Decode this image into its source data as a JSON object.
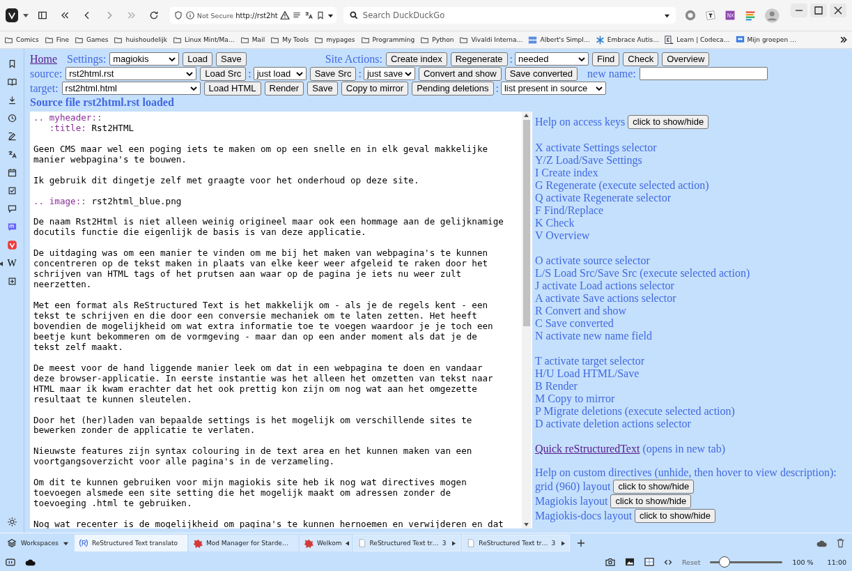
{
  "browser": {
    "address": {
      "security": "Not Secure",
      "url": "http://rst2ht"
    },
    "search": {
      "placeholder": "Search DuckDuckGo"
    }
  },
  "bookmarks": [
    {
      "label": "Comics",
      "kind": "folder"
    },
    {
      "label": "Fine",
      "kind": "folder"
    },
    {
      "label": "Games",
      "kind": "folder"
    },
    {
      "label": "huishoudelijk",
      "kind": "folder"
    },
    {
      "label": "Linux Mint/Ma…",
      "kind": "folder"
    },
    {
      "label": "Mail",
      "kind": "folder"
    },
    {
      "label": "My Tools",
      "kind": "folder"
    },
    {
      "label": "mypages",
      "kind": "folder"
    },
    {
      "label": "Programming",
      "kind": "folder"
    },
    {
      "label": "Python",
      "kind": "folder"
    },
    {
      "label": "Vivaldi Interna…",
      "kind": "folder"
    },
    {
      "label": "Albert's Simpl…",
      "kind": "logs"
    },
    {
      "label": "Embrace Autis…",
      "kind": "snowflake"
    },
    {
      "label": "Learn | Codeca…",
      "kind": "code"
    },
    {
      "label": "Mijn groepen …",
      "kind": "group"
    }
  ],
  "sidebar": {
    "glyph": "W"
  },
  "form": {
    "lines": [
      {
        "controls": [
          {
            "kind": "link",
            "text": "Home"
          },
          {
            "kind": "label",
            "text": "Settings:"
          },
          {
            "kind": "select",
            "value": "magiokis"
          },
          {
            "kind": "button",
            "text": "Load"
          },
          {
            "kind": "button",
            "text": "Save"
          },
          {
            "kind": "section",
            "text": "Site Actions:"
          },
          {
            "kind": "button",
            "text": "Create index"
          },
          {
            "kind": "button",
            "text": "Regenerate"
          },
          {
            "kind": "sep",
            "text": ":"
          },
          {
            "kind": "select",
            "value": "needed"
          },
          {
            "kind": "button",
            "text": "Find"
          },
          {
            "kind": "button",
            "text": "Check"
          },
          {
            "kind": "button",
            "text": "Overview"
          }
        ]
      },
      {
        "controls": [
          {
            "kind": "label",
            "text": "source:"
          },
          {
            "kind": "select",
            "value": "rst2html.rst"
          },
          {
            "kind": "button",
            "text": "Load Src"
          },
          {
            "kind": "sep",
            "text": ":"
          },
          {
            "kind": "select",
            "value": "just load"
          },
          {
            "kind": "button",
            "text": "Save Src"
          },
          {
            "kind": "sep",
            "text": ":"
          },
          {
            "kind": "select",
            "value": "just save"
          },
          {
            "kind": "button",
            "text": "Convert and show"
          },
          {
            "kind": "button",
            "text": "Save converted"
          },
          {
            "kind": "label",
            "text": "new name:"
          },
          {
            "kind": "input"
          }
        ]
      },
      {
        "controls": [
          {
            "kind": "label",
            "text": "target:"
          },
          {
            "kind": "select",
            "value": "rst2html.html"
          },
          {
            "kind": "button",
            "text": "Load HTML"
          },
          {
            "kind": "button",
            "text": "Render"
          },
          {
            "kind": "button",
            "text": "Save"
          },
          {
            "kind": "button",
            "text": "Copy to mirror"
          },
          {
            "kind": "button",
            "text": "Pending deletions"
          },
          {
            "kind": "sep",
            "text": ":"
          },
          {
            "kind": "select",
            "value": "list present in source"
          }
        ]
      }
    ],
    "message": "Source file rst2html.rst loaded"
  },
  "editor": {
    "paragraphs": [
      {
        "lines": [
          {
            "directive": ".. myheader::"
          },
          {
            "directive": "   :title:",
            "text": " Rst2HTML"
          }
        ]
      },
      {
        "lines": [
          {
            "text": "Geen CMS maar wel een poging iets te maken om op een snelle en in elk geval makkelijke"
          },
          {
            "text": "manier webpagina's te bouwen."
          }
        ]
      },
      {
        "lines": [
          {
            "text": "Ik gebruik dit dingetje zelf met graagte voor het onderhoud op deze site."
          }
        ]
      },
      {
        "lines": [
          {
            "directive": ".. image::",
            "text": " rst2html_blue.png"
          }
        ]
      },
      {
        "lines": [
          {
            "text": "De naam Rst2Html is niet alleen weinig origineel maar ook een hommage aan de gelijknamige"
          },
          {
            "text": "docutils functie die eigenlijk de basis is van deze applicatie."
          }
        ]
      },
      {
        "lines": [
          {
            "text": "De uitdaging was om een manier te vinden om me bij het maken van webpagina's te kunnen"
          },
          {
            "text": "concentreren op de tekst maken in plaats van elke keer weer afgeleid te raken door het"
          },
          {
            "text": "schrijven van HTML tags of het prutsen aan waar op de pagina je iets nu weer zult"
          },
          {
            "text": "neerzetten."
          }
        ]
      },
      {
        "lines": [
          {
            "text": "Met een format als ReStructured Text is het makkelijk om - als je de regels kent - een"
          },
          {
            "text": "tekst te schrijven en die door een conversie mechaniek om te laten zetten. Het heeft"
          },
          {
            "text": "bovendien de mogelijkheid om wat extra informatie toe te voegen waardoor je je toch een"
          },
          {
            "text": "beetje kunt bekommeren om de vormgeving - maar dan op een ander moment als dat je de"
          },
          {
            "text": "tekst zelf maakt."
          }
        ]
      },
      {
        "lines": [
          {
            "text": "De meest voor de hand liggende manier leek om dat in een webpagina te doen en vandaar"
          },
          {
            "text": "deze browser-applicatie. In eerste instantie was het alleen het omzetten van tekst naar"
          },
          {
            "text": "HTML maar ik kwam erachter dat het ook prettig kon zijn om nog wat aan het omgezette"
          },
          {
            "text": "resultaat te kunnen sleutelen."
          }
        ]
      },
      {
        "lines": [
          {
            "text": "Door het (her)laden van bepaalde settings is het mogelijk om verschillende sites te"
          },
          {
            "text": "bewerken zonder de applicatie te verlaten."
          }
        ]
      },
      {
        "lines": [
          {
            "text": "Nieuwste features zijn syntax colouring in de text area en het kunnen maken van een"
          },
          {
            "text": "voortgangsoverzicht voor alle pagina's in de verzameling."
          }
        ]
      },
      {
        "lines": [
          {
            "text": "Om dit te kunnen gebruiken voor mijn magiokis site heb ik nog wat directives mogen"
          },
          {
            "text": "toevoegen alsmede een site setting die het mogelijk maakt om adressen zonder de"
          },
          {
            "text": "toevoeging .html te gebruiken."
          }
        ]
      },
      {
        "lines": [
          {
            "text": "Nog wat recenter is de mogelijkheid om pagina's te kunnen hernoemen en verwijderen en dat"
          }
        ]
      }
    ]
  },
  "help": {
    "access": {
      "label": "Help on access keys",
      "button": "click to show/hide"
    },
    "groups": [
      [
        "X activate Settings selector",
        "Y/Z Load/Save Settings",
        "I Create index",
        "G Regenerate (execute selected action)",
        "Q activate Regenerate selector",
        "F Find/Replace",
        "K Check",
        "V Overview"
      ],
      [
        "O activate source selector",
        "L/S Load Src/Save Src (execute selected action)",
        "J activate Load actions selector",
        "A activate Save actions selector",
        "R Convert and show",
        "C Save converted",
        "N activate new name field"
      ],
      [
        "T activate target selector",
        "H/U Load HTML/Save",
        "B Render",
        "M Copy to mirror",
        "P Migrate deletions (execute selected action)",
        "D activate deletion actions selector"
      ]
    ],
    "quick": {
      "link": "Quick reStructuredText",
      "note": "(opens in new tab)"
    },
    "custom": {
      "heading": "Help on custom directives (unhide, then hover to view description):",
      "items": [
        {
          "label": "grid (960) layout",
          "button": "click to show/hide"
        },
        {
          "label": "Magiokis layout",
          "button": "click to show/hide"
        },
        {
          "label": "Magiokis-docs layout",
          "button": "click to show/hide"
        }
      ]
    }
  },
  "tabs": {
    "workspaces": "Workspaces",
    "items": [
      {
        "title": "ReStructured Text translato",
        "selected": true
      },
      {
        "title": "Mod Manager for Starde…",
        "selected": false
      },
      {
        "title": "Welkom",
        "selected": false
      },
      {
        "title": "ReStructured Text tr…",
        "count": "3",
        "selected": false
      },
      {
        "title": "ReStructured Text tr…",
        "count": "3",
        "selected": false
      }
    ]
  },
  "status": {
    "reset": "Reset",
    "zoom": {
      "level": 0.2
    },
    "zoom_label": "100 %",
    "clock": "11:00"
  }
}
